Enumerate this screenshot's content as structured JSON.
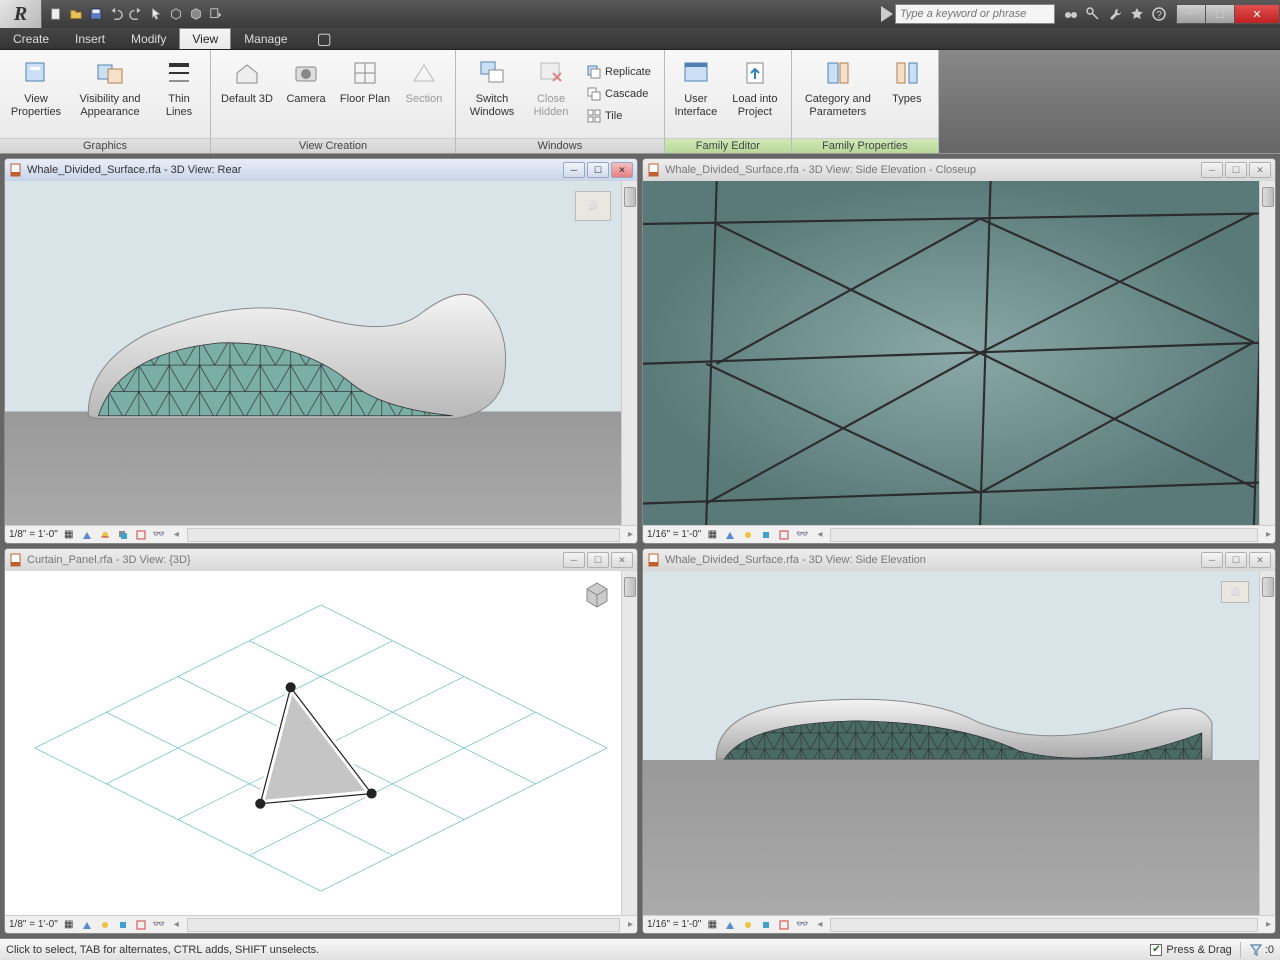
{
  "app": {
    "letter": "R"
  },
  "search": {
    "placeholder": "Type a keyword or phrase"
  },
  "menus": [
    {
      "label": "Create",
      "active": false
    },
    {
      "label": "Insert",
      "active": false
    },
    {
      "label": "Modify",
      "active": false
    },
    {
      "label": "View",
      "active": true
    },
    {
      "label": "Manage",
      "active": false
    }
  ],
  "ribbon": {
    "graphics": {
      "label": "Graphics",
      "btns": {
        "view_props": "View\nProperties",
        "visibility": "Visibility and\nAppearance",
        "thin": "Thin Lines"
      }
    },
    "creation": {
      "label": "View Creation",
      "btns": {
        "default3d": "Default 3D",
        "camera": "Camera",
        "floorplan": "Floor Plan",
        "section": "Section"
      }
    },
    "windows": {
      "label": "Windows",
      "btns": {
        "switch": "Switch\nWindows",
        "close": "Close\nHidden",
        "replicate": "Replicate",
        "cascade": "Cascade",
        "tile": "Tile"
      }
    },
    "familyeditor": {
      "label": "Family Editor",
      "btns": {
        "ui": "User\nInterface",
        "load": "Load into\nProject"
      }
    },
    "familyprops": {
      "label": "Family Properties",
      "btns": {
        "catparams": "Category and\nParameters",
        "types": "Types"
      }
    }
  },
  "views": [
    {
      "title": "Whale_Divided_Surface.rfa - 3D View: Rear",
      "scale": "1/8\" = 1'-0\"",
      "active": true
    },
    {
      "title": "Whale_Divided_Surface.rfa - 3D View: Side Elevation - Closeup",
      "scale": "1/16\" = 1'-0\"",
      "active": false
    },
    {
      "title": "Curtain_Panel.rfa - 3D View: {3D}",
      "scale": "1/8\" = 1'-0\"",
      "active": false
    },
    {
      "title": "Whale_Divided_Surface.rfa - 3D View: Side Elevation",
      "scale": "1/16\" = 1'-0\"",
      "active": false
    }
  ],
  "statusbar": {
    "hint": "Click to select, TAB for alternates, CTRL adds, SHIFT unselects.",
    "pressdrag": "Press & Drag",
    "filtercount": ":0"
  }
}
